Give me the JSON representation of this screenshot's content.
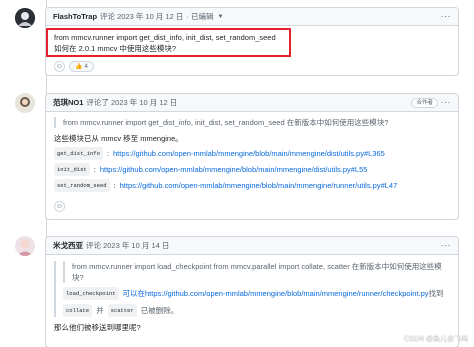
{
  "comments": [
    {
      "author": "FlashToTrap",
      "meta": "评论 2023 年 10 月 12 日",
      "edited": "· 已编辑",
      "lines": [
        "from mmcv.runner import get_dist_info, init_dist, set_random_seed",
        "如何在 2.0.1 mmcv 中使用这些模块?"
      ],
      "reaction_count": "4"
    },
    {
      "author": "范琪NO1",
      "meta": "评论了 2023 年 10 月 12 日",
      "badge": "合作者",
      "quote": "from mmcv.runner import get_dist_info, init_dist, set_random_seed 在新版本中如何使用这些模块?",
      "intro": "这些模块已从 mmcv 移至 mmengine。",
      "items": [
        {
          "code": "get_dist_info",
          "sep": ":",
          "link": "https://github.com/open-mmlab/mmengine/blob/main/mmengine/dist/utils.py#L365"
        },
        {
          "code": "init_dist",
          "sep": ":",
          "link": "https://github.com/open-mmlab/mmengine/blob/main/mmengine/dist/utils.py#L55"
        },
        {
          "code": "set_random_seed",
          "sep": ":",
          "link": "https://github.com/open-mmlab/mmengine/blob/main/mmengine/runner/utils.py#L47"
        }
      ]
    },
    {
      "author": "米戈西亚",
      "meta": "评论 2023 年 10 月 14 日",
      "quote_line1": "from mmcv.runner import load_checkpoint from mmcv.parallel import collate, scatter 在新版本中如何使用这些模块?",
      "quote_code1": "load_checkpoint",
      "quote_text1": "可以在",
      "quote_link1": "https://github.com/open-mmlab/mmengine/blob/main/mmengine/runner/checkpoint.py",
      "quote_tail1": "找到",
      "quote_code2a": "collate",
      "quote_and": "并",
      "quote_code2b": "scatter",
      "quote_tail2": "已被删除。",
      "question": "那么他们被移送到哪里呢?"
    }
  ],
  "watermark": "CSDN @鱼儿会飞吗"
}
